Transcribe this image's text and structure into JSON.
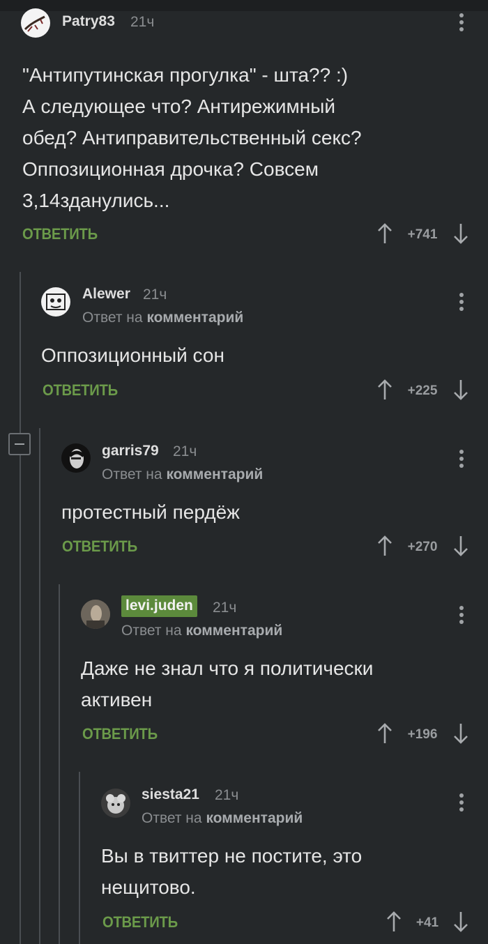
{
  "comments": [
    {
      "author": "Patry83",
      "time": "21ч",
      "reply_prefix": "",
      "reply_target": "",
      "text": "\"Антипутинская прогулка\" - шта?? :)\nА следующее что? Антирежимный\nобед? Антиправительственный секс?\nОппозиционная дрочка? Совсем\n3,14зданулись...",
      "reply_label": "ОТВЕТИТЬ",
      "score": "+741"
    },
    {
      "author": "Alewer",
      "time": "21ч",
      "reply_prefix": "Ответ на",
      "reply_target": "комментарий",
      "text": "Оппозиционный сон",
      "reply_label": "ОТВЕТИТЬ",
      "score": "+225"
    },
    {
      "author": "garris79",
      "time": "21ч",
      "reply_prefix": "Ответ на",
      "reply_target": "комментарий",
      "text": "протестный пердёж",
      "reply_label": "ОТВЕТИТЬ",
      "score": "+270"
    },
    {
      "author": "levi.juden",
      "time": "21ч",
      "reply_prefix": "Ответ на",
      "reply_target": "комментарий",
      "text": "Даже не знал что я политически\nактивен",
      "reply_label": "ОТВЕТИТЬ",
      "score": "+196"
    },
    {
      "author": "siesta21",
      "time": "21ч",
      "reply_prefix": "Ответ на",
      "reply_target": "комментарий",
      "text": "Вы в твиттер не постите, это\nнещитово.",
      "reply_label": "ОТВЕТИТЬ",
      "score": "+41"
    }
  ],
  "colors": {
    "background": "#25282a",
    "accent_green": "#6b9a4a",
    "badge_green": "#5c8a3c",
    "muted": "#8a8d90"
  },
  "icons": [
    "kebab-menu-icon",
    "arrow-up-icon",
    "arrow-down-icon",
    "collapse-minus-icon"
  ]
}
